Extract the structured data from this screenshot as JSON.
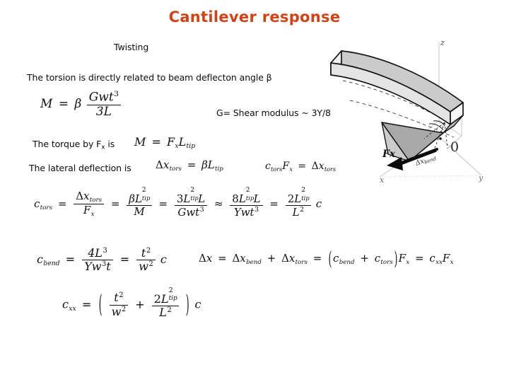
{
  "slide": {
    "title": "Cantilever response",
    "title_color": "#d14314",
    "background": "#ffffff"
  },
  "text": {
    "twisting": "Twisting",
    "torsion_line": "The torsion is directly related to beam deflecton angle β",
    "shear_note": "G= Shear modulus ~ 3Y/8",
    "torque_label": "The torque by F",
    "torque_label_sub": "x",
    "torque_label_tail": " is",
    "lateral_label": "The lateral deflection is"
  },
  "equations": {
    "moment": {
      "lhs": "M",
      "eq": "=",
      "beta": "β",
      "num": "Gwt",
      "num_exp": "3",
      "den": "3L"
    },
    "torque": {
      "lhs": "M",
      "eq": "=",
      "rhs_f": "F",
      "rhs_f_sub": "x",
      "rhs_l": "L",
      "rhs_l_sub": "tip"
    },
    "dx_tors": {
      "lhs_delta": "Δ",
      "lhs_x": "x",
      "lhs_sub": "tors",
      "eq": "=",
      "beta": "β",
      "L": "L",
      "L_sub": "tip"
    },
    "ctors_fx": {
      "c": "c",
      "c_sub": "tors",
      "F": "F",
      "F_sub": "x",
      "eq": "=",
      "delta": "Δ",
      "x": "x",
      "x_sub": "tors"
    },
    "ctors_chain": {
      "lhs_c": "c",
      "lhs_sub": "tors",
      "eq1": "=",
      "f1_num_delta": "Δ",
      "f1_num_x": "x",
      "f1_num_sub": "tors",
      "f1_den_F": "F",
      "f1_den_sub": "x",
      "eq2": "=",
      "f2_num_beta": "β",
      "f2_num_L": "L",
      "f2_num_exp": "2",
      "f2_num_sub": "tip",
      "f2_den": "M",
      "eq3": "=",
      "f3_num_coef": "3",
      "f3_num_L": "L",
      "f3_num_exp": "2",
      "f3_num_sub": "tip",
      "f3_num_tail": "L",
      "f3_den": "Gwt",
      "f3_den_exp": "3",
      "approx": "≈",
      "f4_num_coef": "8",
      "f4_num_L": "L",
      "f4_num_exp": "2",
      "f4_num_sub": "tip",
      "f4_num_tail": "L",
      "f4_den": "Ywt",
      "f4_den_exp": "3",
      "eq4": "=",
      "f5_num_coef": "2",
      "f5_num_L": "L",
      "f5_num_exp": "2",
      "f5_num_sub": "tip",
      "f5_den": "L",
      "f5_den_exp": "2",
      "tail_c": "c"
    },
    "cbend": {
      "lhs_c": "c",
      "lhs_sub": "bend",
      "eq1": "=",
      "f1_num": "4L",
      "f1_num_exp": "3",
      "f1_den_Y": "Yw",
      "f1_den_exp": "3",
      "f1_den_t": "t",
      "eq2": "=",
      "f2_num": "t",
      "f2_num_exp": "2",
      "f2_den": "w",
      "f2_den_exp": "2",
      "tail_c": "c"
    },
    "dx_total": {
      "delta1": "Δ",
      "x1": "x",
      "eq1": "=",
      "delta2": "Δ",
      "x2": "x",
      "x2_sub": "bend",
      "plus": "+",
      "delta3": "Δ",
      "x3": "x",
      "x3_sub": "tors",
      "eq2": "=",
      "paren_open": "(",
      "c1": "c",
      "c1_sub": "bend",
      "plus2": "+",
      "c2": "c",
      "c2_sub": "tors",
      "paren_close": ")",
      "F1": "F",
      "F1_sub": "x",
      "eq3": "=",
      "cxx": "c",
      "cxx_sub": "xx",
      "F2": "F",
      "F2_sub": "x"
    },
    "cxx": {
      "lhs_c": "c",
      "lhs_sub": "xx",
      "eq": "=",
      "paren_open": "(",
      "f1_num": "t",
      "f1_num_exp": "2",
      "f1_den": "w",
      "f1_den_exp": "2",
      "plus": "+",
      "f2_num_coef": "2",
      "f2_num_L": "L",
      "f2_num_exp": "2",
      "f2_num_sub": "tip",
      "f2_den": "L",
      "f2_den_exp": "2",
      "paren_close": ")",
      "tail_c": "c"
    }
  },
  "figure": {
    "name": "cantilever-beam-3d-diagram",
    "axis_z": "z",
    "axis_x": "x",
    "axis_y": "y",
    "origin": "0",
    "force_label": "Fx",
    "deflection_label_delta": "Δ",
    "deflection_label_x": "x",
    "deflection_label_sub": "bend",
    "beam_top_color": "#c9c9c9",
    "beam_side_color": "#f2f2f2",
    "beam_under_color": "#9a9a9a",
    "outline_color": "#1a1a1a",
    "axis_color": "#bdbdbd"
  }
}
